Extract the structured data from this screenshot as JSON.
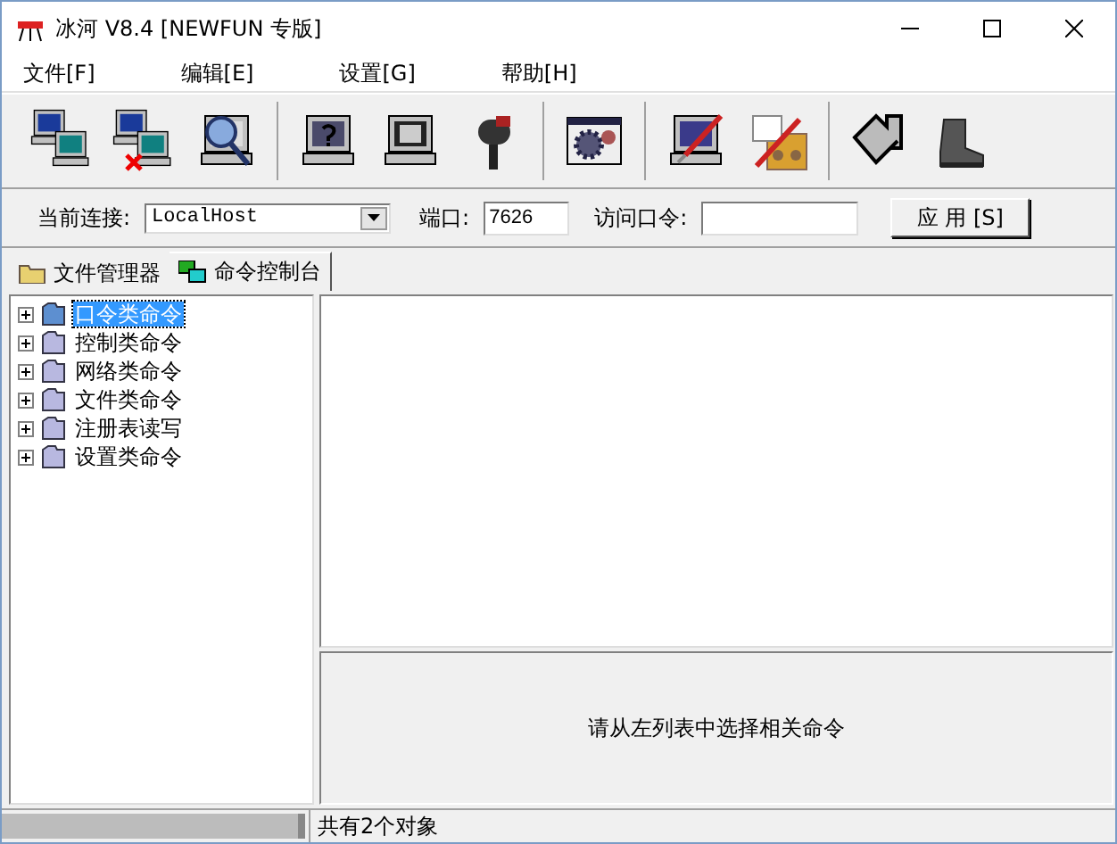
{
  "window": {
    "title": "冰河 V8.4 [NEWFUN 专版]"
  },
  "menu": [
    "文件[F]",
    "编辑[E]",
    "设置[G]",
    "帮助[H]"
  ],
  "connection": {
    "label": "当前连接:",
    "host": "LocalHost",
    "port_label": "端口:",
    "port": "7626",
    "password_label": "访问口令:",
    "apply": "应 用 [S]"
  },
  "tabs": [
    {
      "label": "文件管理器",
      "selected": false
    },
    {
      "label": "命令控制台",
      "selected": true
    }
  ],
  "tree": [
    {
      "label": "口令类命令",
      "selected": true,
      "expanded": false
    },
    {
      "label": "控制类命令",
      "selected": false,
      "expanded": false
    },
    {
      "label": "网络类命令",
      "selected": false,
      "expanded": false
    },
    {
      "label": "文件类命令",
      "selected": false,
      "expanded": false
    },
    {
      "label": "注册表读写",
      "selected": false,
      "expanded": false
    },
    {
      "label": "设置类命令",
      "selected": false,
      "expanded": false
    }
  ],
  "hint": "请从左列表中选择相关命令",
  "status_bar": {
    "text": "共有2个对象"
  }
}
